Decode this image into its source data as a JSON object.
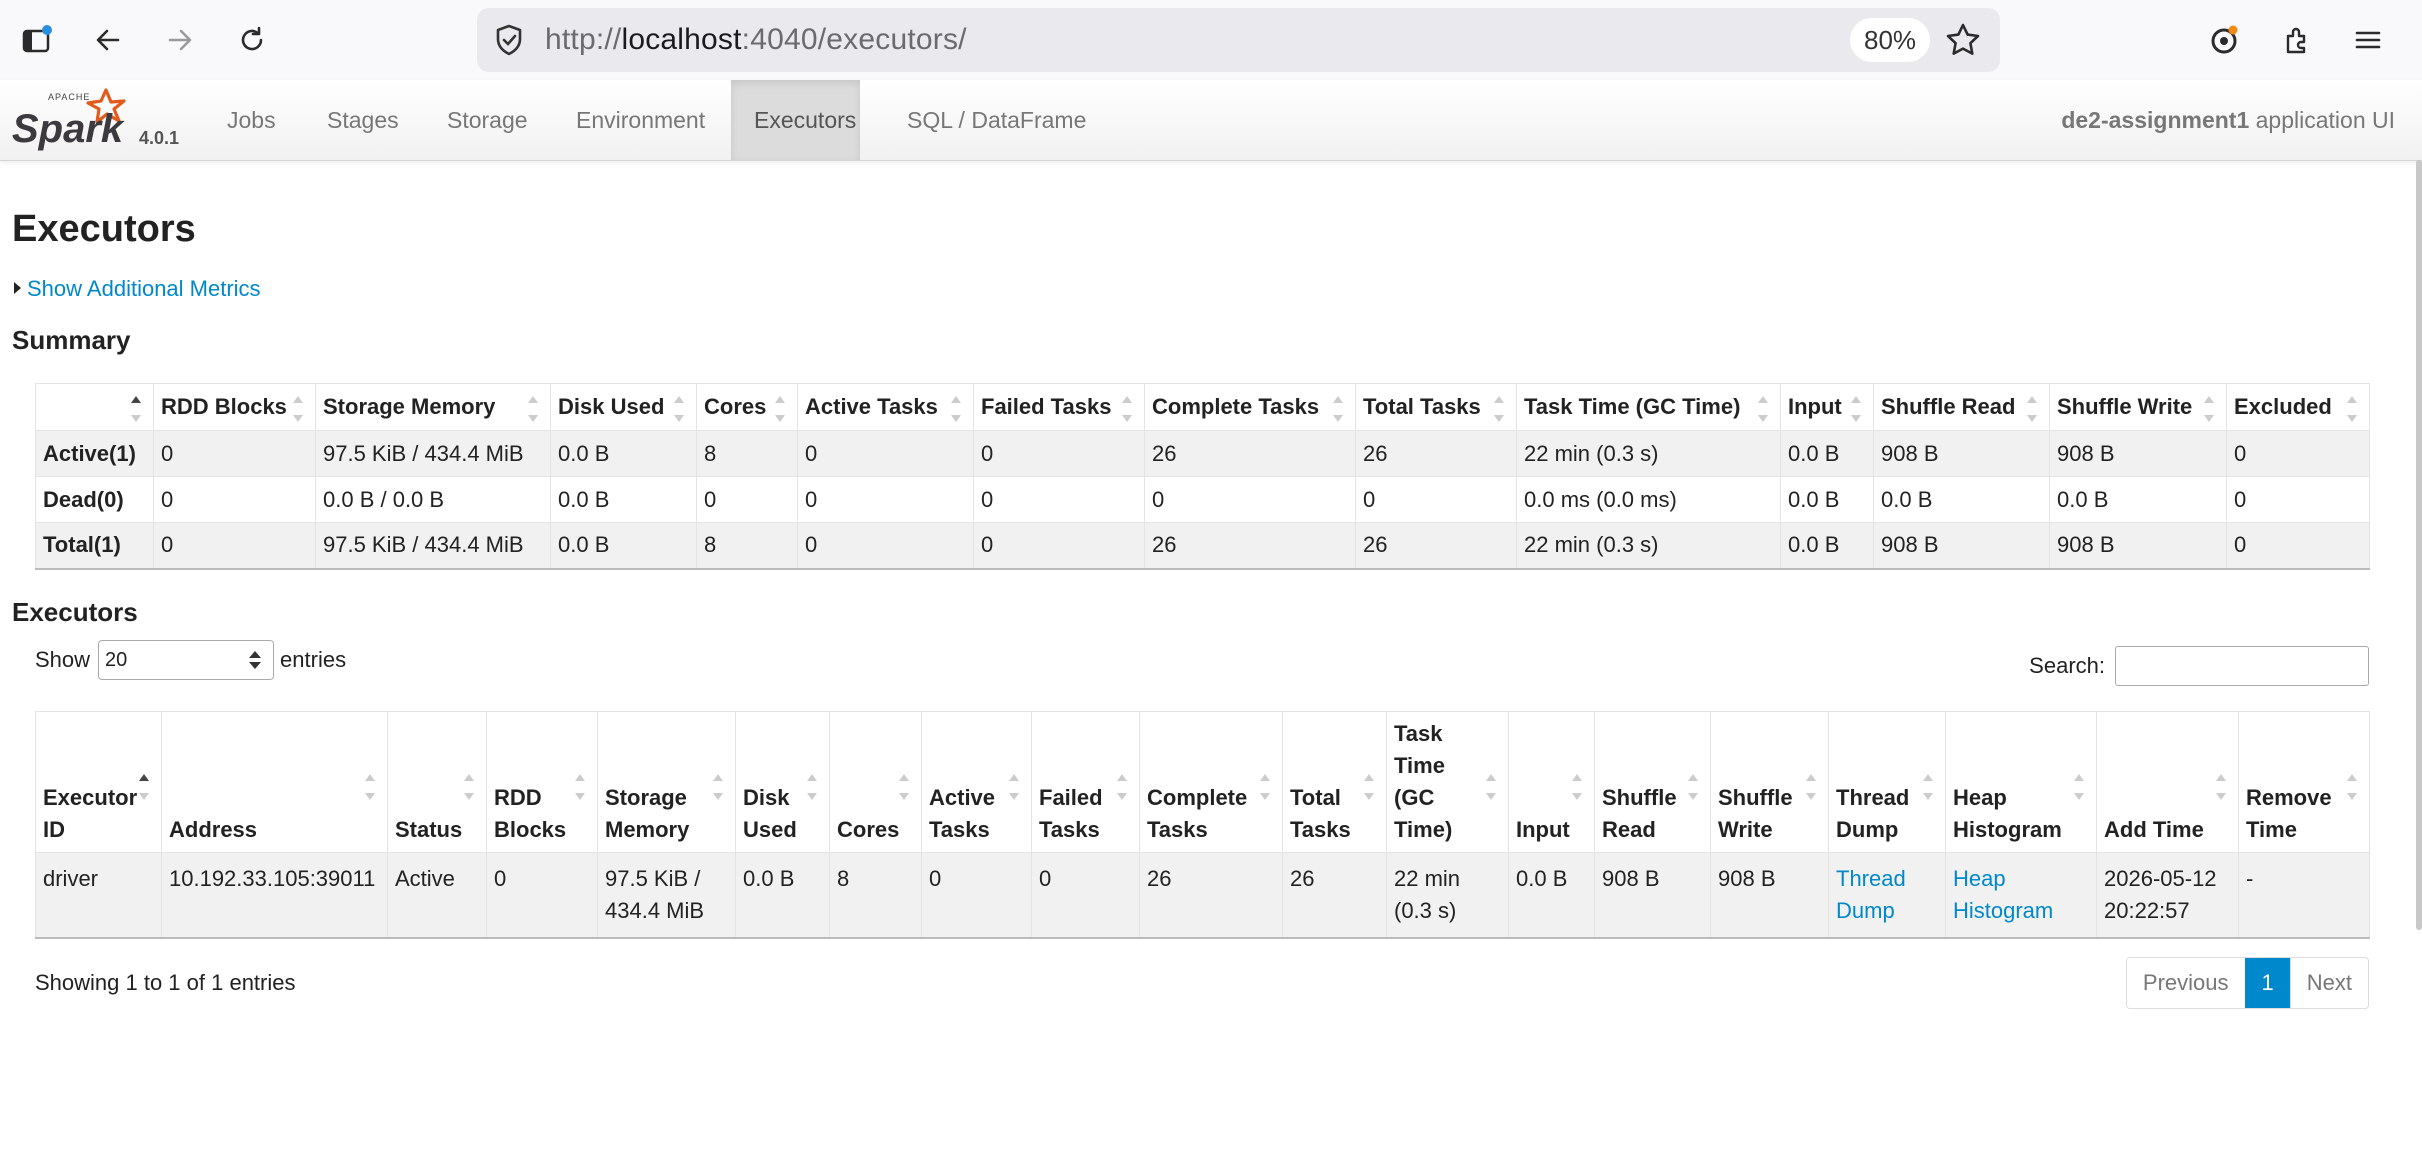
{
  "browser": {
    "url_scheme": "http://",
    "url_host": "localhost",
    "url_rest": ":4040/executors/",
    "zoom": "80%"
  },
  "navbar": {
    "version": "4.0.1",
    "tabs": [
      {
        "label": "Jobs"
      },
      {
        "label": "Stages"
      },
      {
        "label": "Storage"
      },
      {
        "label": "Environment"
      },
      {
        "label": "Executors"
      },
      {
        "label": "SQL / DataFrame"
      }
    ],
    "active_tab": "Executors",
    "app_name": "de2-assignment1",
    "app_suffix": " application UI"
  },
  "page": {
    "title": "Executors",
    "show_metrics_link": "Show Additional Metrics",
    "summary_title": "Summary",
    "executors_title": "Executors"
  },
  "summary": {
    "headers": [
      "",
      "RDD Blocks",
      "Storage Memory",
      "Disk Used",
      "Cores",
      "Active Tasks",
      "Failed Tasks",
      "Complete Tasks",
      "Total Tasks",
      "Task Time (GC Time)",
      "Input",
      "Shuffle Read",
      "Shuffle Write",
      "Excluded"
    ],
    "rows": [
      [
        "Active(1)",
        "0",
        "97.5 KiB / 434.4 MiB",
        "0.0 B",
        "8",
        "0",
        "0",
        "26",
        "26",
        "22 min (0.3 s)",
        "0.0 B",
        "908 B",
        "908 B",
        "0"
      ],
      [
        "Dead(0)",
        "0",
        "0.0 B / 0.0 B",
        "0.0 B",
        "0",
        "0",
        "0",
        "0",
        "0",
        "0.0 ms (0.0 ms)",
        "0.0 B",
        "0.0 B",
        "0.0 B",
        "0"
      ],
      [
        "Total(1)",
        "0",
        "97.5 KiB / 434.4 MiB",
        "0.0 B",
        "8",
        "0",
        "0",
        "26",
        "26",
        "22 min (0.3 s)",
        "0.0 B",
        "908 B",
        "908 B",
        "0"
      ]
    ]
  },
  "executors_table": {
    "show_label": "Show",
    "entries_value": "20",
    "entries_label": "entries",
    "search_label": "Search:",
    "search_value": "",
    "headers": [
      "Executor ID",
      "Address",
      "Status",
      "RDD Blocks",
      "Storage Memory",
      "Disk Used",
      "Cores",
      "Active Tasks",
      "Failed Tasks",
      "Complete Tasks",
      "Total Tasks",
      "Task Time (GC Time)",
      "Input",
      "Shuffle Read",
      "Shuffle Write",
      "Thread Dump",
      "Heap Histogram",
      "Add Time",
      "Remove Time"
    ],
    "rows": [
      [
        "driver",
        "10.192.33.105:39011",
        "Active",
        "0",
        "97.5 KiB / 434.4 MiB",
        "0.0 B",
        "8",
        "0",
        "0",
        "26",
        "26",
        "22 min (0.3 s)",
        "0.0 B",
        "908 B",
        "908 B",
        "Thread Dump",
        "Heap Histogram",
        "2026-05-12 20:22:57",
        "-"
      ]
    ],
    "info": "Showing 1 to 1 of 1 entries",
    "pager": {
      "previous": "Previous",
      "current": "1",
      "next": "Next"
    }
  },
  "colors": {
    "link": "#0088cc",
    "logo_orange": "#e25a1c"
  }
}
